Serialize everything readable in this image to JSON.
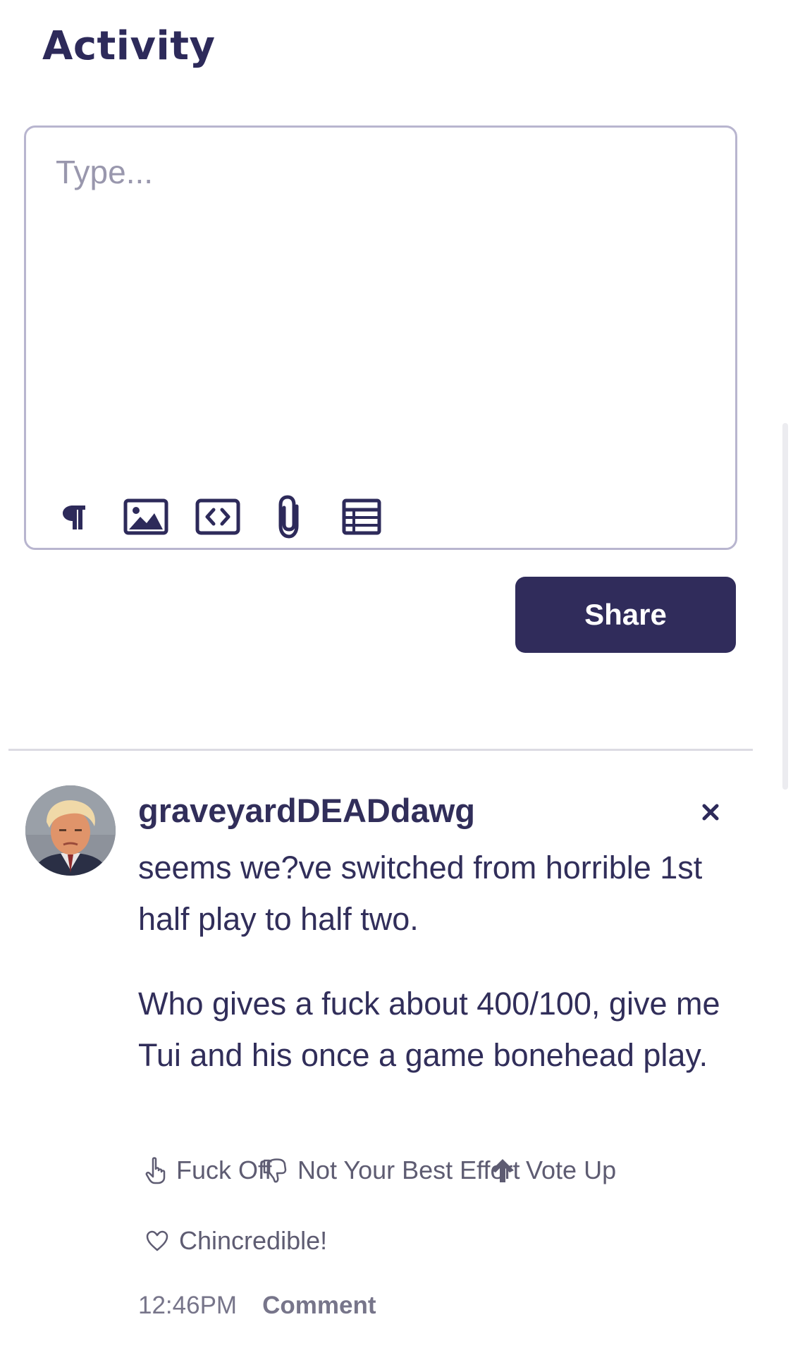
{
  "page": {
    "title": "Activity"
  },
  "editor": {
    "placeholder": "Type...",
    "value": "",
    "toolbar": [
      {
        "icon": "paragraph-icon"
      },
      {
        "icon": "image-icon"
      },
      {
        "icon": "code-icon"
      },
      {
        "icon": "paperclip-icon"
      },
      {
        "icon": "table-icon"
      }
    ]
  },
  "share_label": "Share",
  "post": {
    "username": "graveyardDEADdawg",
    "avatar": "user-avatar",
    "paragraphs": [
      "seems we?ve switched from horrible 1st half play to half two.",
      "Who gives a fuck about 400/100, give me Tui and his once a game bonehead play."
    ],
    "reactions": [
      {
        "icon": "pointing-hand-icon",
        "label": "Fuck Off"
      },
      {
        "icon": "thumbs-down-icon",
        "label": "Not Your Best Effort"
      },
      {
        "icon": "arrow-up-icon",
        "label": "Vote Up"
      },
      {
        "icon": "heart-icon",
        "label": "Chincredible!"
      }
    ],
    "time": "12:46PM",
    "comment_label": "Comment"
  },
  "colors": {
    "primary": "#302c5b",
    "text": "#312e5a",
    "muted": "#77758a",
    "border": "#b8b5cf"
  }
}
